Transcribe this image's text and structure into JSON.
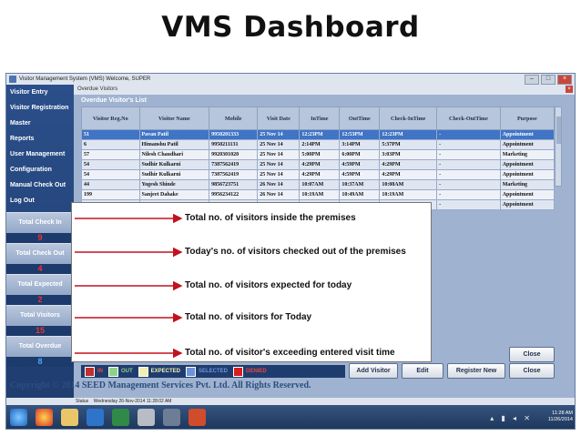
{
  "slide": {
    "title": "VMS Dashboard"
  },
  "window": {
    "title": "Visitor Management System (VMS)  Welcome, SUPER"
  },
  "sidebar": {
    "items": [
      "Visitor Entry",
      "Visitor Registration",
      "Master",
      "Reports",
      "User Management",
      "Configuration",
      "Manual Check Out",
      "Log Out"
    ]
  },
  "stats": [
    {
      "label": "Total Check In",
      "value": "9"
    },
    {
      "label": "Total Check Out",
      "value": "4"
    },
    {
      "label": "Total Expected",
      "value": "2"
    },
    {
      "label": "Total Visitors",
      "value": "15"
    },
    {
      "label": "Total Overdue",
      "value": "8"
    }
  ],
  "panel": {
    "tab_title": "Overdue Visitors",
    "group_title": "Overdue Visitor's List",
    "columns": [
      "Visitor Reg.No",
      "Visitor Name",
      "Mobile",
      "Visit Date",
      "InTime",
      "OutTime",
      "Check-InTime",
      "Check-OutTime",
      "Purpose"
    ],
    "rows": [
      [
        "51",
        "Pavan Patil",
        "9950201333",
        "25 Nov 14",
        "12:23PM",
        "12:53PM",
        "12:23PM",
        "-",
        "Appointment"
      ],
      [
        "6",
        "Himanshu Patil",
        "9950211131",
        "25 Nov 14",
        "2:14PM",
        "3:14PM",
        "5:37PM",
        "-",
        "Appointment"
      ],
      [
        "57",
        "Nilesh Chaudhari",
        "9920301020",
        "25 Nov 14",
        "5:00PM",
        "6:00PM",
        "3:03PM",
        "-",
        "Marketing"
      ],
      [
        "54",
        "Sudhir Kulkarni",
        "7387562419",
        "25 Nov 14",
        "4:29PM",
        "4:59PM",
        "4:29PM",
        "-",
        "Appointment"
      ],
      [
        "54",
        "Sudhir Kulkarni",
        "7387562419",
        "25 Nov 14",
        "4:29PM",
        "4:59PM",
        "4:29PM",
        "-",
        "Appointment"
      ],
      [
        "44",
        "Yogesh Shinde",
        "9856723751",
        "26 Nov 14",
        "10:07AM",
        "10:37AM",
        "10:08AM",
        "-",
        "Marketing"
      ],
      [
        "199",
        "Sanjeet Dahake",
        "9956234122",
        "26 Nov 14",
        "10:19AM",
        "10:49AM",
        "10:19AM",
        "-",
        "Appointment"
      ],
      [
        "",
        "",
        "",
        "",
        "",
        "",
        "",
        "-",
        "Appointment"
      ]
    ]
  },
  "legend": [
    {
      "label": "IN",
      "color": "#c0302c"
    },
    {
      "label": "OUT",
      "color": "#8fd18a"
    },
    {
      "label": "EXPECTED",
      "color": "#f2efb0"
    },
    {
      "label": "SELECTED",
      "color": "#6d93d9"
    },
    {
      "label": "DENIED",
      "color": "#d81e1e"
    }
  ],
  "buttons": {
    "close_panel": "Close",
    "add_visitor": "Add Visitor",
    "edit": "Edit",
    "register_new": "Register New",
    "close": "Close"
  },
  "footer": {
    "copyright": "Copyright © 2014 SEED Management Services Pvt. Ltd. All Rights Reserved.",
    "status_label": "Status",
    "status_value": "Wednesday 26-Nov-2014 11:28:02 AM"
  },
  "tray": {
    "time": "11:28 AM",
    "date": "11/26/2014"
  },
  "annotations": [
    "Total no. of visitors inside the premises",
    "Today's no. of visitors checked out of the premises",
    "Total no. of visitors expected for today",
    "Total no. of visitors for Today",
    "Total no. of visitor's exceeding entered visit time"
  ]
}
